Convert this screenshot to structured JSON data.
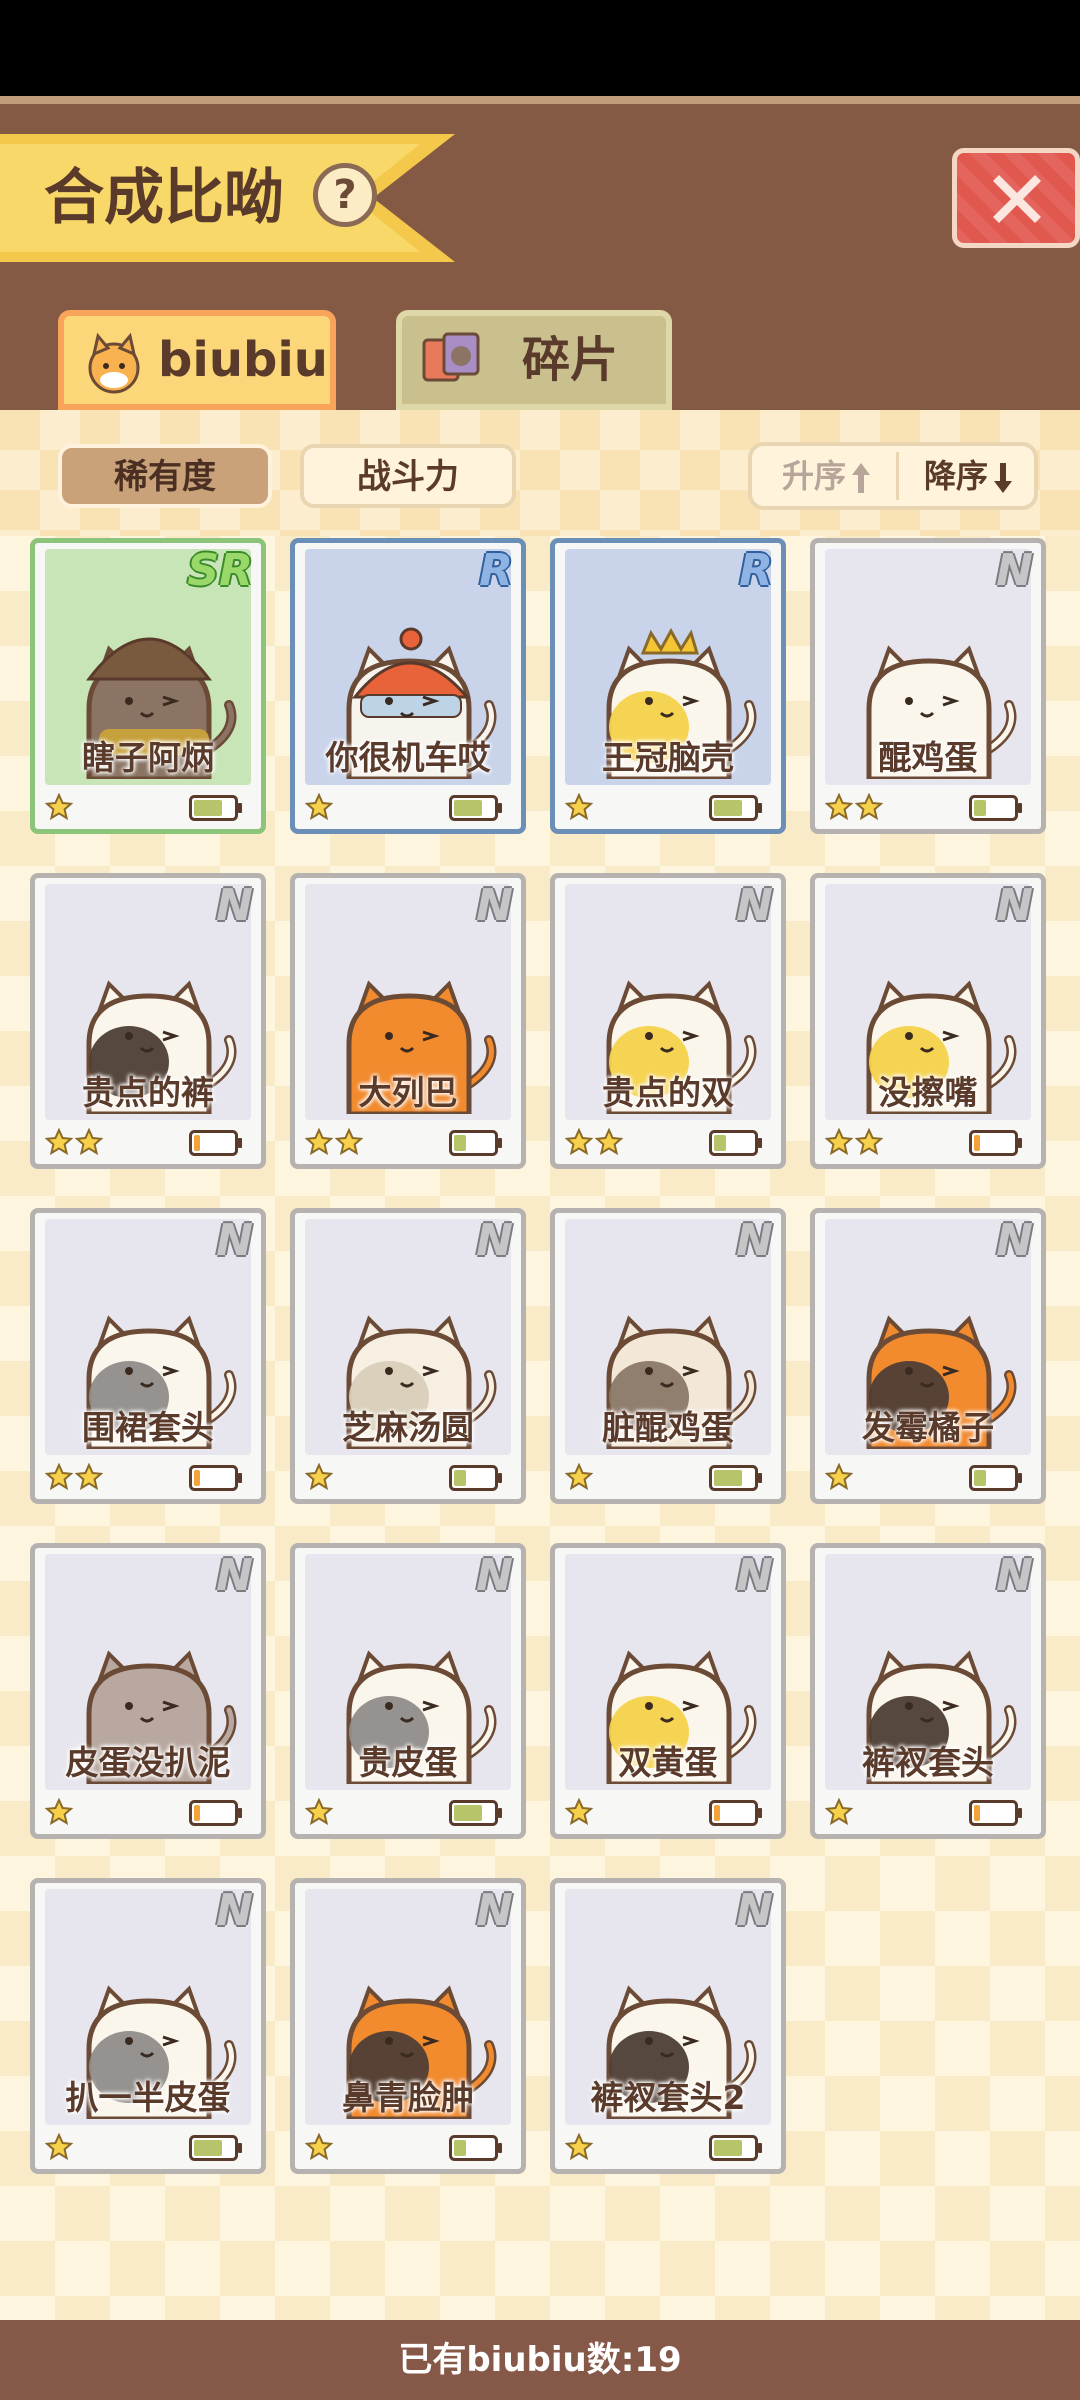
{
  "title": "合成比呦",
  "help_label": "?",
  "tabs": [
    {
      "label": "biubiu",
      "active": true
    },
    {
      "label": "碎片",
      "active": false
    }
  ],
  "sort_options": [
    {
      "label": "稀有度",
      "active": true
    },
    {
      "label": "战斗力",
      "active": false
    }
  ],
  "order": {
    "asc_label": "升序",
    "desc_label": "降序",
    "active": "desc"
  },
  "colors": {
    "header_bg": "#855a45",
    "accent_yellow": "#f7d869",
    "close_red": "#e1584f",
    "text_brown": "#5a3a2a",
    "N_border": "#b5b2b0",
    "R_border": "#6c8fb8",
    "SR_border": "#8cc57a"
  },
  "cards": [
    {
      "name": "瞎子阿炳",
      "rarity": "SR",
      "stars": 1,
      "energy": 0.7,
      "icon": "cat-witch-hat"
    },
    {
      "name": "你很机车哎",
      "rarity": "R",
      "stars": 1,
      "energy": 0.7,
      "icon": "cat-helmet"
    },
    {
      "name": "王冠脑壳",
      "rarity": "R",
      "stars": 1,
      "energy": 0.7,
      "icon": "cat-crown"
    },
    {
      "name": "醌鸡蛋",
      "rarity": "N",
      "stars": 2,
      "energy": 0.3,
      "icon": "cat-white"
    },
    {
      "name": "贵点的裤",
      "rarity": "N",
      "stars": 2,
      "energy": 0.15,
      "icon": "cat-black-patch"
    },
    {
      "name": "大列巴",
      "rarity": "N",
      "stars": 2,
      "energy": 0.3,
      "icon": "cat-orange"
    },
    {
      "name": "贵点的双",
      "rarity": "N",
      "stars": 2,
      "energy": 0.3,
      "icon": "cat-yellow-patch"
    },
    {
      "name": "没擦嘴",
      "rarity": "N",
      "stars": 2,
      "energy": 0.15,
      "icon": "cat-yellow-ear"
    },
    {
      "name": "围裙套头",
      "rarity": "N",
      "stars": 2,
      "energy": 0.15,
      "icon": "cat-gray-patch"
    },
    {
      "name": "芝麻汤圆",
      "rarity": "N",
      "stars": 1,
      "energy": 0.3,
      "icon": "cat-cream"
    },
    {
      "name": "脏醌鸡蛋",
      "rarity": "N",
      "stars": 1,
      "energy": 0.7,
      "icon": "cat-spotted"
    },
    {
      "name": "发霉橘子",
      "rarity": "N",
      "stars": 1,
      "energy": 0.3,
      "icon": "cat-calico"
    },
    {
      "name": "皮蛋没扒泥",
      "rarity": "N",
      "stars": 1,
      "energy": 0.15,
      "icon": "cat-gray"
    },
    {
      "name": "贵皮蛋",
      "rarity": "N",
      "stars": 1,
      "energy": 0.7,
      "icon": "cat-gray-head"
    },
    {
      "name": "双黄蛋",
      "rarity": "N",
      "stars": 1,
      "energy": 0.15,
      "icon": "cat-double-yellow"
    },
    {
      "name": "裤衩套头",
      "rarity": "N",
      "stars": 1,
      "energy": 0.15,
      "icon": "cat-black-head"
    },
    {
      "name": "扒一半皮蛋",
      "rarity": "N",
      "stars": 1,
      "energy": 0.7,
      "icon": "cat-half-gray"
    },
    {
      "name": "鼻青脸肿",
      "rarity": "N",
      "stars": 1,
      "energy": 0.3,
      "icon": "cat-orange-black"
    },
    {
      "name": "裤衩套头2",
      "rarity": "N",
      "stars": 1,
      "energy": 0.7,
      "icon": "cat-black-head-2"
    }
  ],
  "footer": "已有biubiu数:19"
}
